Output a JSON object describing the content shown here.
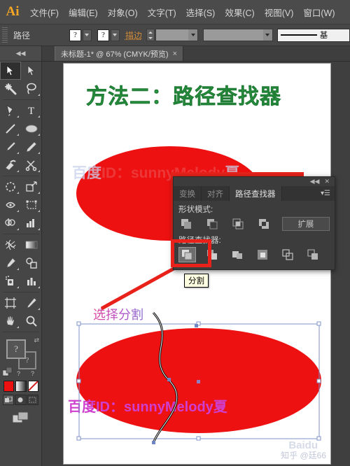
{
  "app": {
    "logo": "Ai",
    "menu": [
      {
        "label": "文件(F)"
      },
      {
        "label": "编辑(E)"
      },
      {
        "label": "对象(O)"
      },
      {
        "label": "文字(T)"
      },
      {
        "label": "选择(S)"
      },
      {
        "label": "效果(C)"
      },
      {
        "label": "视图(V)"
      },
      {
        "label": "窗口(W)"
      }
    ]
  },
  "controlbar": {
    "object_label": "路径",
    "fill_swatch": "?",
    "stroke_swatch": "?",
    "stroke_label": "描边",
    "weight_value": "",
    "profile_value": "",
    "stroke_style_label": "基"
  },
  "tabstrip": {
    "collapse_icon": "◀◀",
    "document_tab": "未标题-1* @ 67% (CMYK/预览)",
    "close_icon": "×"
  },
  "tools": {
    "items": [
      {
        "name": "selection-tool",
        "sel": true
      },
      {
        "name": "direct-selection-tool",
        "sel": false
      },
      {
        "name": "magic-wand-tool",
        "sel": false
      },
      {
        "name": "lasso-tool",
        "sel": false
      },
      {
        "name": "pen-tool",
        "sel": false
      },
      {
        "name": "type-tool",
        "sel": false
      },
      {
        "name": "line-segment-tool",
        "sel": false
      },
      {
        "name": "ellipse-tool",
        "sel": false
      },
      {
        "name": "paintbrush-tool",
        "sel": false
      },
      {
        "name": "pencil-tool",
        "sel": false
      },
      {
        "name": "blob-brush-tool",
        "sel": false
      },
      {
        "name": "eraser-scissors-tool",
        "sel": false
      },
      {
        "name": "rotate-tool",
        "sel": false
      },
      {
        "name": "scale-tool",
        "sel": false
      },
      {
        "name": "width-tool",
        "sel": false
      },
      {
        "name": "free-transform-tool",
        "sel": false
      },
      {
        "name": "shape-builder-tool",
        "sel": false
      },
      {
        "name": "perspective-grid-tool",
        "sel": false
      },
      {
        "name": "mesh-tool",
        "sel": false
      },
      {
        "name": "gradient-tool",
        "sel": false
      },
      {
        "name": "eyedropper-tool",
        "sel": false
      },
      {
        "name": "blend-tool",
        "sel": false
      },
      {
        "name": "symbol-sprayer-tool",
        "sel": false
      },
      {
        "name": "column-graph-tool",
        "sel": false
      },
      {
        "name": "artboard-tool",
        "sel": false
      },
      {
        "name": "slice-tool",
        "sel": false
      },
      {
        "name": "hand-tool",
        "sel": false
      },
      {
        "name": "zoom-tool",
        "sel": false
      }
    ],
    "fill_glyph": "?",
    "stroke_glyph": "?",
    "swap_glyph": "⇄",
    "none_glyph": "?",
    "none_glyph2": "?",
    "colors": {
      "fill_color": "#ee1111",
      "gradient_from": "#ffffff",
      "gradient_to": "#2b2b2b",
      "none_slash": "#d42020"
    }
  },
  "artboard": {
    "title": "方法二：路径查找器",
    "title_color": "#2b9d45",
    "watermark_top_prefix": "百度",
    "watermark_top_id": "ID：sunnyMelody",
    "watermark_top_suffix": "夏",
    "watermark_bottom": "百度ID：sunnyMelody夏",
    "watermark_bottom_color": "#cf3fcf",
    "note": "选择分割",
    "shape_fill": "#ee1111",
    "zhihu_watermark": "知乎 @廷66",
    "baidu_watermark": "Baidu"
  },
  "pathfinder": {
    "collapse_icon": "◀◀",
    "close_icon": "✕",
    "menu_icon": "▾☰",
    "tabs": [
      {
        "label": "变换",
        "active": false
      },
      {
        "label": "对齐",
        "active": false
      },
      {
        "label": "路径查找器",
        "active": true
      }
    ],
    "shape_modes_label": "形状模式:",
    "shape_mode_buttons": [
      {
        "name": "unite"
      },
      {
        "name": "minus-front"
      },
      {
        "name": "intersect"
      },
      {
        "name": "exclude"
      }
    ],
    "expand_label": "扩展",
    "pathfinders_label": "路径查找器:",
    "pathfinder_buttons": [
      {
        "name": "divide",
        "highlighted": true
      },
      {
        "name": "trim",
        "highlighted": false
      },
      {
        "name": "merge",
        "highlighted": false
      },
      {
        "name": "crop",
        "highlighted": false
      },
      {
        "name": "outline",
        "highlighted": false
      },
      {
        "name": "minus-back",
        "highlighted": false
      }
    ],
    "tooltip": "分割",
    "highlight_color": "#e8221b"
  }
}
